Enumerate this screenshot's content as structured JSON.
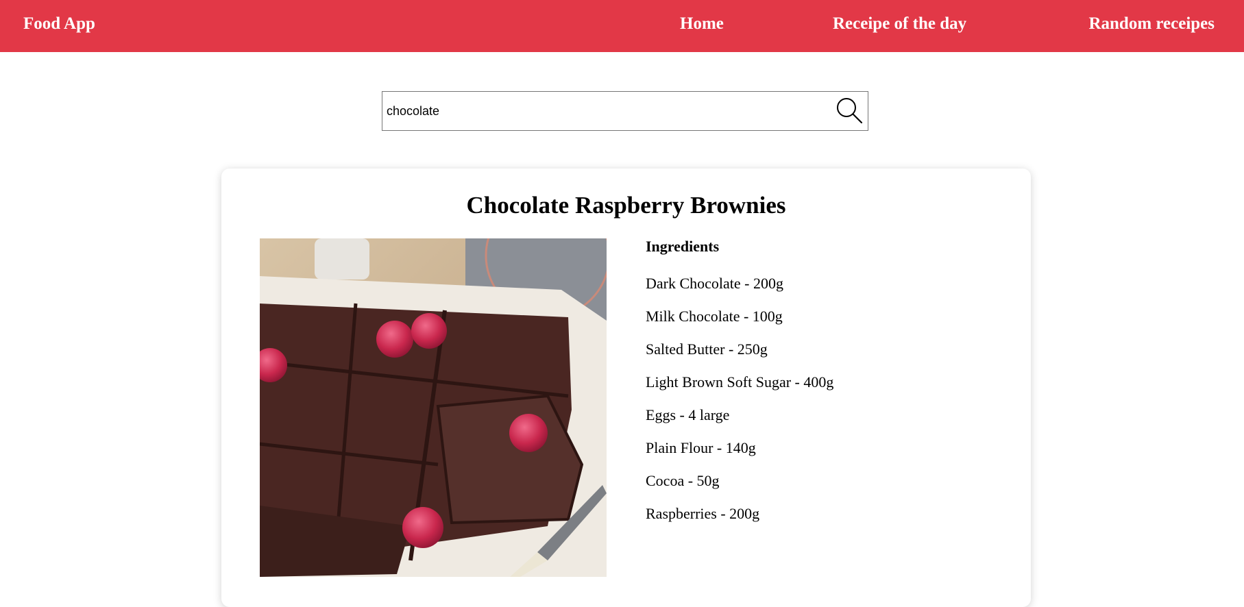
{
  "nav": {
    "brand": "Food App",
    "links": [
      "Home",
      "Receipe of the day",
      "Random receipes"
    ],
    "background_color": "#e23847"
  },
  "search": {
    "value": "chocolate",
    "icon": "search-icon"
  },
  "recipe": {
    "title": "Chocolate Raspberry Brownies",
    "ingredients_heading": "Ingredients",
    "ingredients": [
      "Dark Chocolate - 200g",
      "Milk Chocolate - 100g",
      "Salted Butter - 250g",
      "Light Brown Soft Sugar - 400g",
      "Eggs - 4 large",
      "Plain Flour - 140g",
      "Cocoa - 50g",
      "Raspberries - 200g"
    ]
  }
}
